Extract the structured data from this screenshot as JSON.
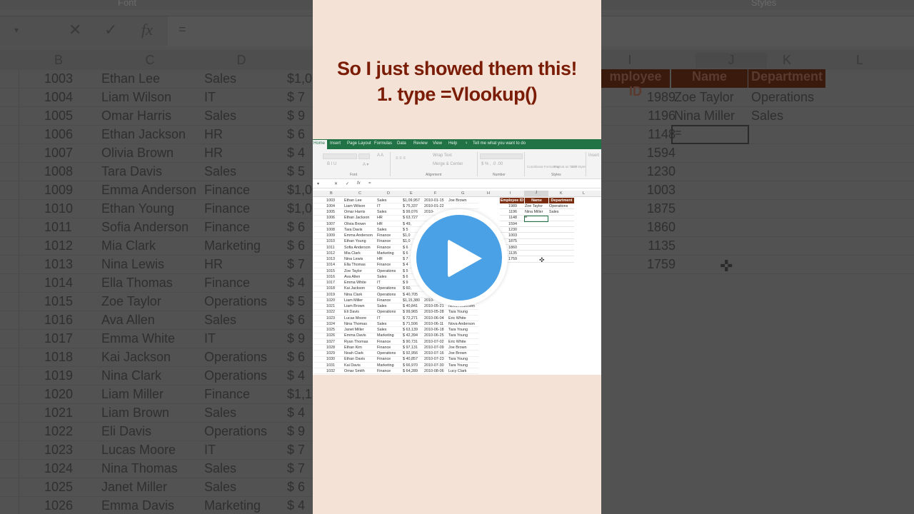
{
  "overlay": {
    "title_line1": "So I just showed them this!",
    "title_line2": "1. type =Vlookup()",
    "play_button": "play-icon"
  },
  "colors": {
    "title": "#7a1c06",
    "panel_bg": "#f3e2d5",
    "excel_green": "#217346",
    "header_fill": "#7a2d0e",
    "play_blue": "#4aa1e6"
  },
  "excel": {
    "tabs": [
      "Home",
      "Insert",
      "Page Layout",
      "Formulas",
      "Data",
      "Review",
      "View",
      "Help"
    ],
    "tell_me": "Tell me what you want to do",
    "ribbon_groups": [
      "Font",
      "Alignment",
      "Number",
      "Styles"
    ],
    "ribbon_buttons": {
      "wrap_text": "Wrap Text",
      "merge_center": "Merge & Center",
      "conditional_formatting": "Conditional Formatting",
      "format_as_table": "Format as Table",
      "cell_styles": "Cell Styles",
      "insert": "Insert"
    },
    "formula_bar": {
      "cancel": "✕",
      "enter": "✓",
      "fx": "fx",
      "value": "="
    },
    "columns": [
      "B",
      "C",
      "D",
      "E",
      "F",
      "G",
      "H",
      "I",
      "J",
      "K",
      "L"
    ],
    "rows": [
      {
        "id": "1003",
        "name": "Ethan Lee",
        "dept": "Sales",
        "salary": "$1,09,957",
        "date": "2010-01-15",
        "manager": "Joe Brown"
      },
      {
        "id": "1004",
        "name": "Liam Wilson",
        "dept": "IT",
        "salary": "$   75,337",
        "date": "2010-01-22",
        "manager": ""
      },
      {
        "id": "1005",
        "name": "Omar Harris",
        "dept": "Sales",
        "salary": "$   99,076",
        "date": "2010-",
        "manager": ""
      },
      {
        "id": "1006",
        "name": "Ethan Jackson",
        "dept": "HR",
        "salary": "$   63,727",
        "date": "",
        "manager": ""
      },
      {
        "id": "1007",
        "name": "Olivia Brown",
        "dept": "HR",
        "salary": "$   49,",
        "date": "",
        "manager": ""
      },
      {
        "id": "1008",
        "name": "Tara Davis",
        "dept": "Sales",
        "salary": "$   5",
        "date": "",
        "manager": ""
      },
      {
        "id": "1009",
        "name": "Emma Anderson",
        "dept": "Finance",
        "salary": "$1,0",
        "date": "",
        "manager": ""
      },
      {
        "id": "1010",
        "name": "Ethan Young",
        "dept": "Finance",
        "salary": "$1,0",
        "date": "",
        "manager": ""
      },
      {
        "id": "1011",
        "name": "Sofia Anderson",
        "dept": "Finance",
        "salary": "$   6",
        "date": "",
        "manager": ""
      },
      {
        "id": "1012",
        "name": "Mia Clark",
        "dept": "Marketing",
        "salary": "$   6",
        "date": "",
        "manager": ""
      },
      {
        "id": "1013",
        "name": "Nina Lewis",
        "dept": "HR",
        "salary": "$   7",
        "date": "",
        "manager": ""
      },
      {
        "id": "1014",
        "name": "Ella Thomas",
        "dept": "Finance",
        "salary": "$   4",
        "date": "",
        "manager": ""
      },
      {
        "id": "1015",
        "name": "Zoe Taylor",
        "dept": "Operations",
        "salary": "$   5",
        "date": "",
        "manager": ""
      },
      {
        "id": "1016",
        "name": "Ava Allen",
        "dept": "Sales",
        "salary": "$   6",
        "date": "",
        "manager": ""
      },
      {
        "id": "1017",
        "name": "Emma White",
        "dept": "IT",
        "salary": "$   9",
        "date": "",
        "manager": ""
      },
      {
        "id": "1018",
        "name": "Kai Jackson",
        "dept": "Operations",
        "salary": "$   60,",
        "date": "",
        "manager": ""
      },
      {
        "id": "1019",
        "name": "Nina Clark",
        "dept": "Operations",
        "salary": "$   40,705",
        "date": "",
        "manager": ""
      },
      {
        "id": "1020",
        "name": "Liam Miller",
        "dept": "Finance",
        "salary": "$1,15,380",
        "date": "2010-",
        "manager": ""
      },
      {
        "id": "1021",
        "name": "Liam Brown",
        "dept": "Sales",
        "salary": "$   40,841",
        "date": "2010-05-21",
        "manager": "Nova Anderson"
      },
      {
        "id": "1022",
        "name": "Eli Davis",
        "dept": "Operations",
        "salary": "$   99,965",
        "date": "2010-05-28",
        "manager": "Tara Young"
      },
      {
        "id": "1023",
        "name": "Lucas Moore",
        "dept": "IT",
        "salary": "$   72,271",
        "date": "2010-06-04",
        "manager": "Eric White"
      },
      {
        "id": "1024",
        "name": "Nina Thomas",
        "dept": "Sales",
        "salary": "$   71,506",
        "date": "2010-06-11",
        "manager": "Nova Anderson"
      },
      {
        "id": "1025",
        "name": "Janet Miller",
        "dept": "Sales",
        "salary": "$   63,139",
        "date": "2010-06-18",
        "manager": "Tara Young"
      },
      {
        "id": "1026",
        "name": "Emma Davis",
        "dept": "Marketing",
        "salary": "$   42,394",
        "date": "2010-06-25",
        "manager": "Tara Young"
      },
      {
        "id": "1027",
        "name": "Ryan Thomas",
        "dept": "Finance",
        "salary": "$   90,731",
        "date": "2010-07-02",
        "manager": "Eric White"
      },
      {
        "id": "1028",
        "name": "Ethan Kim",
        "dept": "Finance",
        "salary": "$   97,131",
        "date": "2010-07-09",
        "manager": "Joe Brown"
      },
      {
        "id": "1029",
        "name": "Noah Clark",
        "dept": "Operations",
        "salary": "$   92,956",
        "date": "2010-07-16",
        "manager": "Joe Brown"
      },
      {
        "id": "1030",
        "name": "Ethan Davis",
        "dept": "Finance",
        "salary": "$   40,857",
        "date": "2010-07-23",
        "manager": "Tara Young"
      },
      {
        "id": "1031",
        "name": "Kai Davis",
        "dept": "Marketing",
        "salary": "$   66,970",
        "date": "2010-07-30",
        "manager": "Tara Young"
      },
      {
        "id": "1032",
        "name": "Omar Smith",
        "dept": "Finance",
        "salary": "$   64,289",
        "date": "2010-08-06",
        "manager": "Lucy Clark"
      }
    ],
    "lookup_table": {
      "headers": [
        "Employee ID",
        "Name",
        "Department"
      ],
      "rows": [
        {
          "id": "1989",
          "name": "Zoe Taylor",
          "dept": "Operations"
        },
        {
          "id": "1196",
          "name": "Nina Miller",
          "dept": "Sales"
        },
        {
          "id": "1148",
          "name": "=",
          "dept": ""
        },
        {
          "id": "1594",
          "name": "",
          "dept": ""
        },
        {
          "id": "1230",
          "name": "",
          "dept": ""
        },
        {
          "id": "1003",
          "name": "",
          "dept": ""
        },
        {
          "id": "1875",
          "name": "",
          "dept": ""
        },
        {
          "id": "1860",
          "name": "",
          "dept": ""
        },
        {
          "id": "1135",
          "name": "",
          "dept": ""
        },
        {
          "id": "1759",
          "name": "",
          "dept": ""
        }
      ],
      "active_cell_value": "="
    }
  },
  "background": {
    "ribbon_labels": [
      "Font",
      "Styles"
    ],
    "col_headers": [
      "B",
      "C",
      "D",
      "I",
      "J",
      "K",
      "L"
    ],
    "rows": [
      {
        "id": "1003",
        "name": "Ethan Lee",
        "dept": "Sales",
        "salary": "$1,0"
      },
      {
        "id": "1004",
        "name": "Liam Wilson",
        "dept": "IT",
        "salary": "$   7"
      },
      {
        "id": "1005",
        "name": "Omar Harris",
        "dept": "Sales",
        "salary": "$   9"
      },
      {
        "id": "1006",
        "name": "Ethan Jackson",
        "dept": "HR",
        "salary": "$   6"
      },
      {
        "id": "1007",
        "name": "Olivia Brown",
        "dept": "HR",
        "salary": "$   4"
      },
      {
        "id": "1008",
        "name": "Tara Davis",
        "dept": "Sales",
        "salary": "$   5"
      },
      {
        "id": "1009",
        "name": "Emma Anderson",
        "dept": "Finance",
        "salary": "$1,0"
      },
      {
        "id": "1010",
        "name": "Ethan Young",
        "dept": "Finance",
        "salary": "$1,0"
      },
      {
        "id": "1011",
        "name": "Sofia Anderson",
        "dept": "Finance",
        "salary": "$   6"
      },
      {
        "id": "1012",
        "name": "Mia Clark",
        "dept": "Marketing",
        "salary": "$   6"
      },
      {
        "id": "1013",
        "name": "Nina Lewis",
        "dept": "HR",
        "salary": "$   7"
      },
      {
        "id": "1014",
        "name": "Ella Thomas",
        "dept": "Finance",
        "salary": "$   4"
      },
      {
        "id": "1015",
        "name": "Zoe Taylor",
        "dept": "Operations",
        "salary": "$   5"
      },
      {
        "id": "1016",
        "name": "Ava Allen",
        "dept": "Sales",
        "salary": "$   6"
      },
      {
        "id": "1017",
        "name": "Emma White",
        "dept": "IT",
        "salary": "$   9"
      },
      {
        "id": "1018",
        "name": "Kai Jackson",
        "dept": "Operations",
        "salary": "$   6"
      },
      {
        "id": "1019",
        "name": "Nina Clark",
        "dept": "Operations",
        "salary": "$   4"
      },
      {
        "id": "1020",
        "name": "Liam Miller",
        "dept": "Finance",
        "salary": "$1,1"
      },
      {
        "id": "1021",
        "name": "Liam Brown",
        "dept": "Sales",
        "salary": "$   4"
      },
      {
        "id": "1022",
        "name": "Eli Davis",
        "dept": "Operations",
        "salary": "$   9"
      },
      {
        "id": "1023",
        "name": "Lucas Moore",
        "dept": "IT",
        "salary": "$   7"
      },
      {
        "id": "1024",
        "name": "Nina Thomas",
        "dept": "Sales",
        "salary": "$   7"
      },
      {
        "id": "1025",
        "name": "Janet Miller",
        "dept": "Sales",
        "salary": "$   6"
      },
      {
        "id": "1026",
        "name": "Emma Davis",
        "dept": "Marketing",
        "salary": "$   4"
      }
    ],
    "lookup_headers": [
      "mployee ID",
      "Name",
      "Department"
    ],
    "lookup_rows": [
      {
        "id": "1989",
        "name": "Zoe Taylor",
        "dept": "Operations"
      },
      {
        "id": "1196",
        "name": "Nina Miller",
        "dept": "Sales"
      },
      {
        "id": "1148",
        "name": "",
        "dept": ""
      },
      {
        "id": "1594",
        "name": "",
        "dept": ""
      },
      {
        "id": "1230",
        "name": "",
        "dept": ""
      },
      {
        "id": "1003",
        "name": "",
        "dept": ""
      },
      {
        "id": "1875",
        "name": "",
        "dept": ""
      },
      {
        "id": "1860",
        "name": "",
        "dept": ""
      },
      {
        "id": "1135",
        "name": "",
        "dept": ""
      },
      {
        "id": "1759",
        "name": "",
        "dept": ""
      }
    ]
  }
}
